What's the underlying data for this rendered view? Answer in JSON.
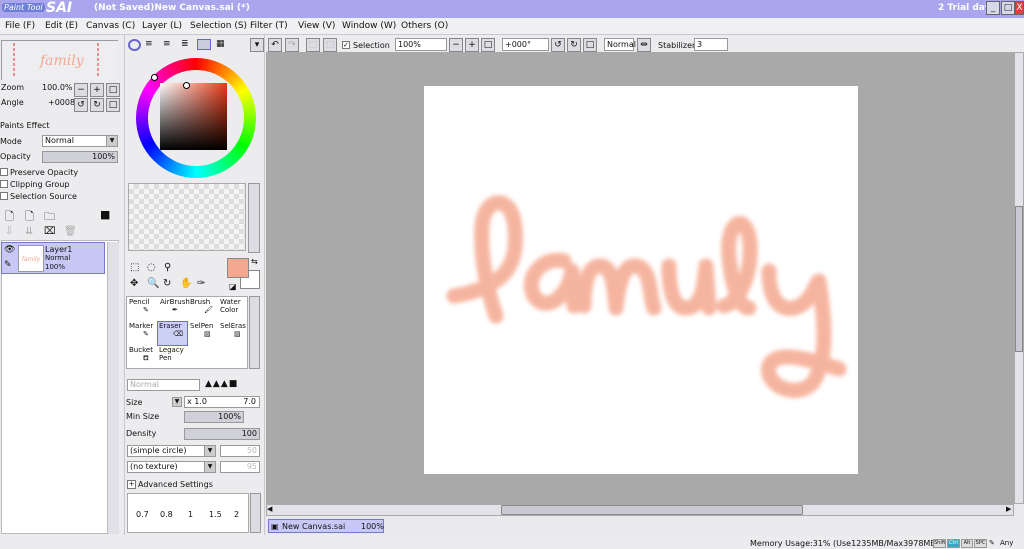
{
  "app": {
    "logo_small": "Paint Tool",
    "logo_big": "SAI",
    "window_title": "(Not Saved)New Canvas.sai (*)",
    "trial": "2 Trial day"
  },
  "window_buttons": {
    "minimize": "_",
    "maximize": "□",
    "close": "X"
  },
  "menu": [
    "File (F)",
    "Edit (E)",
    "Canvas (C)",
    "Layer (L)",
    "Selection (S)",
    "Filter (T)",
    "View (V)",
    "Window (W)",
    "Others (O)"
  ],
  "navigator": {
    "zoom_label": "Zoom",
    "zoom_value": "100.0%",
    "angle_label": "Angle",
    "angle_value": "+0008"
  },
  "layer_props": {
    "paints_effect": "Paints Effect",
    "mode_label": "Mode",
    "mode_value": "Normal",
    "opacity_label": "Opacity",
    "opacity_value": "100%",
    "preserve_opacity": "Preserve Opacity",
    "clipping_group": "Clipping Group",
    "selection_source": "Selection Source"
  },
  "layers": [
    {
      "name": "Layer1",
      "mode": "Normal",
      "opacity": "100%",
      "thumb_text": "family"
    }
  ],
  "toolbar": {
    "selection_label": "Selection",
    "zoom": "100%",
    "rotation": "+000°",
    "blend": "Normal",
    "stabilizer_label": "Stabilizer",
    "stabilizer_value": "3"
  },
  "tools": [
    {
      "label": "Pencil"
    },
    {
      "label": "AirBrush"
    },
    {
      "label": "Brush"
    },
    {
      "label": "Water Color"
    },
    {
      "label": "Marker"
    },
    {
      "label": "Eraser"
    },
    {
      "label": "SelPen"
    },
    {
      "label": "SelEras"
    },
    {
      "label": "Bucket"
    },
    {
      "label": "Legacy Pen"
    }
  ],
  "brush": {
    "mode": "Normal",
    "size_label": "Size",
    "size_mult": "x 1.0",
    "size_value": "7.0",
    "min_size_label": "Min Size",
    "min_size_value": "100%",
    "density_label": "Density",
    "density_value": "100",
    "shape": "(simple circle)",
    "shape_value": "50",
    "texture": "(no texture)",
    "texture_value": "95",
    "advanced": "Advanced Settings",
    "presets": [
      "0.7",
      "0.8",
      "1",
      "1.5",
      "2"
    ]
  },
  "canvas": {
    "text": "family",
    "color": "#f4a88f"
  },
  "canvas_tab": {
    "name": "New Canvas.sai",
    "zoom": "100%"
  },
  "status": {
    "memory": "Memory Usage:31% (Use1235MB/Max3978MB)",
    "keys": [
      "Shift",
      "Ctrl",
      "Alt",
      "SPC"
    ],
    "any": "Any"
  },
  "colors": {
    "title": "#a9a6ee",
    "selected": "#c8c8f6",
    "fg_color": "#f4a88f"
  }
}
